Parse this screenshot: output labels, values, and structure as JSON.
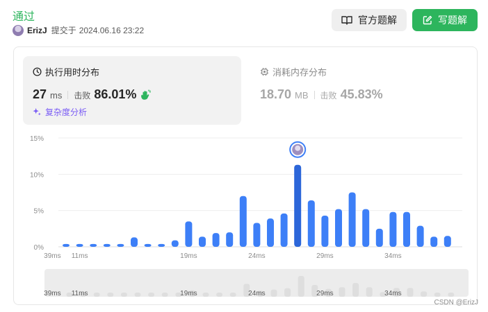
{
  "header": {
    "status": "通过",
    "username": "ErizJ",
    "submitted_label": "提交于",
    "submitted_time": "2024.06.16 23:22"
  },
  "actions": {
    "official_label": "官方题解",
    "write_label": "写题解"
  },
  "runtime": {
    "title": "执行用时分布",
    "value": "27",
    "unit": "ms",
    "beat_label": "击败",
    "beat_value": "86.01%",
    "complexity_label": "复杂度分析"
  },
  "memory": {
    "title": "消耗内存分布",
    "value": "18.70",
    "unit": "MB",
    "beat_label": "击败",
    "beat_value": "45.83%"
  },
  "colors": {
    "accent_green": "#2db55d",
    "bar_blue": "#3d7ff7",
    "bar_highlight": "#2c66d9",
    "complexity_purple": "#7a5cf5"
  },
  "watermark": "CSDN @ErizJ",
  "chart_data": {
    "type": "bar",
    "x": [
      10,
      11,
      12,
      13,
      14,
      15,
      16,
      17,
      18,
      19,
      20,
      21,
      22,
      23,
      24,
      25,
      26,
      27,
      28,
      29,
      30,
      31,
      32,
      33,
      34,
      35,
      36,
      37,
      38,
      39,
      40
    ],
    "values": [
      0.4,
      0.4,
      0.4,
      0.4,
      0.4,
      1.3,
      0.4,
      0.4,
      0.9,
      3.5,
      1.4,
      1.9,
      2.0,
      7.0,
      3.3,
      3.9,
      4.6,
      11.3,
      6.4,
      4.3,
      5.2,
      7.5,
      5.2,
      2.5,
      4.8,
      4.8,
      2.9,
      1.4,
      1.5
    ],
    "highlight_x": 27,
    "ylim": [
      0,
      15
    ],
    "y_ticks": [
      0,
      5,
      10,
      15
    ],
    "y_tick_labels": [
      "0%",
      "5%",
      "10%",
      "15%"
    ],
    "x_tick_labels": [
      {
        "x": 11,
        "label": "11ms"
      },
      {
        "x": 19,
        "label": "19ms"
      },
      {
        "x": 24,
        "label": "24ms"
      },
      {
        "x": 29,
        "label": "29ms"
      },
      {
        "x": 34,
        "label": "34ms"
      },
      {
        "x": 39,
        "label": "39ms"
      }
    ],
    "grid": true,
    "brush_values": [
      0.4,
      0.4,
      0.4,
      0.4,
      0.4,
      1.3,
      0.4,
      0.4,
      0.9,
      3.5,
      1.4,
      1.9,
      2.0,
      7.0,
      3.3,
      3.9,
      4.6,
      11.3,
      6.4,
      4.3,
      5.2,
      7.5,
      5.2,
      2.5,
      4.8,
      4.8,
      2.9,
      1.4,
      1.5
    ]
  }
}
